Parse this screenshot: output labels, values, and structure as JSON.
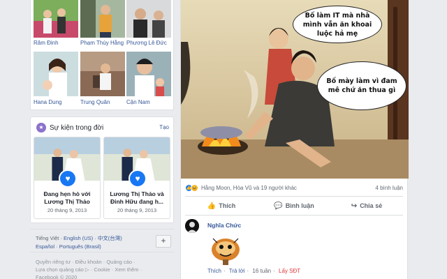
{
  "friends": [
    {
      "name": "Răm Đinh"
    },
    {
      "name": "Phạm Thùy Hằng"
    },
    {
      "name": "Phương Lê Đức"
    },
    {
      "name": "Hana Dung"
    },
    {
      "name": "Trung Quân"
    },
    {
      "name": "Cận Nam"
    }
  ],
  "life_events": {
    "title": "Sự kiện trong đời",
    "create_label": "Tạo",
    "items": [
      {
        "title": "Đang hẹn hò với Lương Thị Thảo",
        "date": "20 tháng 9, 2013"
      },
      {
        "title": "Lương Thị Thảo và Đinh Hữu đang h...",
        "date": "20 tháng 9, 2013"
      }
    ]
  },
  "languages": {
    "current": "Tiếng Việt",
    "options": [
      "English (US)",
      "中文(台灣)",
      "Español",
      "Português (Brasil)"
    ],
    "more_label": "+"
  },
  "footer": {
    "line1": "Quyền riêng tư · Điều khoản · Quảng cáo ·",
    "line2": "Lựa chọn quảng cáo ▷ · Cookie · Xem thêm ·",
    "line3": "Facebook © 2020"
  },
  "post": {
    "bubble_1": "Bố làm IT mà nhà mình vẫn ăn khoai luộc hả mẹ",
    "bubble_2": "Bố mày làm vì đam mê chứ ăn thua gì",
    "reactions_text": "Hằng Moon, Hòa Vũ và 19 người khác",
    "comments_count": "4 bình luận",
    "actions": {
      "like": "Thích",
      "comment": "Bình luận",
      "share": "Chia sẻ"
    }
  },
  "comment": {
    "author": "Nghĩa Chức",
    "like_label": "Thích",
    "reply_label": "Trả lời",
    "time": "16 tuần",
    "extra_label": "Lấy SĐT"
  },
  "colors": {
    "link": "#385898",
    "facebook_blue": "#1877f2",
    "background": "#e9ebee",
    "event_icon": "#8c72cb"
  }
}
